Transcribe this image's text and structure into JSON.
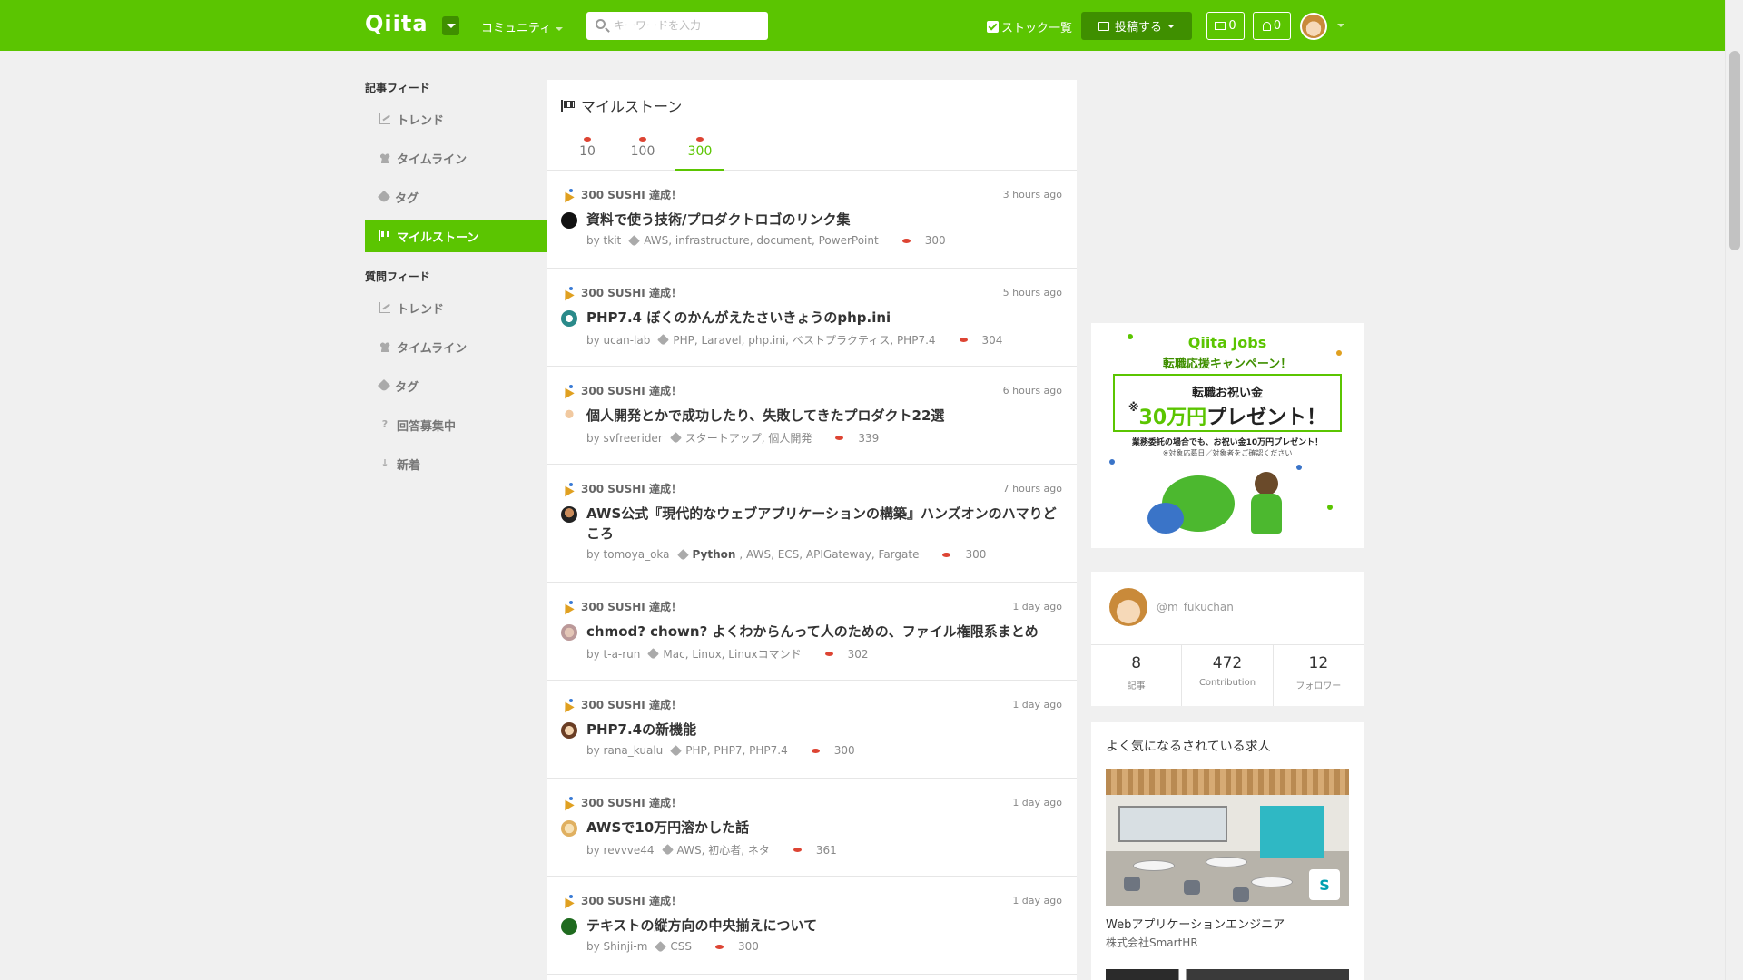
{
  "header": {
    "logo": "Qiita",
    "community": "コミュニティ",
    "search_placeholder": "キーワードを入力",
    "stock_list": "ストック一覧",
    "post_button": "投稿する",
    "mail_count": "0",
    "notification_count": "0"
  },
  "sidebar": {
    "article_feed_heading": "記事フィード",
    "article_items": [
      {
        "label": "トレンド",
        "icon": "trend-icon"
      },
      {
        "label": "タイムライン",
        "icon": "timeline-icon"
      },
      {
        "label": "タグ",
        "icon": "tag-icon"
      },
      {
        "label": "マイルストーン",
        "icon": "flag-icon",
        "active": true
      }
    ],
    "question_feed_heading": "質問フィード",
    "question_items": [
      {
        "label": "トレンド",
        "icon": "trend-icon"
      },
      {
        "label": "タイムライン",
        "icon": "timeline-icon"
      },
      {
        "label": "タグ",
        "icon": "tag-icon"
      },
      {
        "label": "回答募集中",
        "icon": "question-icon"
      },
      {
        "label": "新着",
        "icon": "sort-icon"
      }
    ]
  },
  "main": {
    "title": "マイルストーン",
    "tabs": [
      {
        "label": "10"
      },
      {
        "label": "100"
      },
      {
        "label": "300",
        "active": true
      }
    ],
    "items": [
      {
        "badge": "300 SUSHI 達成！",
        "time": "3 hours ago",
        "title": "資料で使う技術/プロダクトロゴのリンク集",
        "by": "by tkit",
        "tags": "AWS, infrastructure, document, PowerPoint",
        "count": "300"
      },
      {
        "badge": "300 SUSHI 達成！",
        "time": "5 hours ago",
        "title": "PHP7.4 ぼくのかんがえたさいきょうのphp.ini",
        "by": "by ucan-lab",
        "tags": "PHP, Laravel, php.ini, ベストプラクティス, PHP7.4",
        "count": "304"
      },
      {
        "badge": "300 SUSHI 達成！",
        "time": "6 hours ago",
        "title": "個人開発とかで成功したり、失敗してきたプロダクト22選",
        "by": "by svfreerider",
        "tags": "スタートアップ, 個人開発",
        "count": "339"
      },
      {
        "badge": "300 SUSHI 達成！",
        "time": "7 hours ago",
        "title": "AWS公式『現代的なウェブアプリケーションの構築』ハンズオンのハマりどころ",
        "by": "by tomoya_oka",
        "tag_strong": "Python",
        "tags": ", AWS, ECS, APIGateway, Fargate",
        "count": "300"
      },
      {
        "badge": "300 SUSHI 達成！",
        "time": "1 day ago",
        "title": "chmod? chown? よくわからんって人のための、ファイル権限系まとめ",
        "by": "by t-a-run",
        "tags": "Mac, Linux, Linuxコマンド",
        "count": "302"
      },
      {
        "badge": "300 SUSHI 達成！",
        "time": "1 day ago",
        "title": "PHP7.4の新機能",
        "by": "by rana_kualu",
        "tags": "PHP, PHP7, PHP7.4",
        "count": "300"
      },
      {
        "badge": "300 SUSHI 達成！",
        "time": "1 day ago",
        "title": "AWSで10万円溶かした話",
        "by": "by revvve44",
        "tags": "AWS, 初心者, ネタ",
        "count": "361"
      },
      {
        "badge": "300 SUSHI 達成！",
        "time": "1 day ago",
        "title": "テキストの縦方向の中央揃えについて",
        "by": "by Shinji-m",
        "tags": "CSS",
        "count": "300"
      }
    ]
  },
  "ad": {
    "jobs_prefix": "Qiita",
    "jobs_suffix": "Jobs",
    "campaign": "転職応援キャンペーン！",
    "gift": "転職お祝い金",
    "prize_mark": "※",
    "prize_amount": "30万円",
    "prize_suffix": "プレゼント！",
    "note": "業務委託の場合でも、お祝い金10万円プレゼント！",
    "note2": "※対象応募日／対象者をご確認ください"
  },
  "profile": {
    "username": "@m_fukuchan",
    "stats": [
      {
        "value": "8",
        "label": "記事"
      },
      {
        "value": "472",
        "label": "Contribution"
      },
      {
        "value": "12",
        "label": "フォロワー"
      }
    ]
  },
  "jobs": {
    "title": "よく気になるされている求人",
    "badge_letter": "S",
    "role": "Webアプリケーションエンジニア",
    "company": "株式会社SmartHR"
  }
}
